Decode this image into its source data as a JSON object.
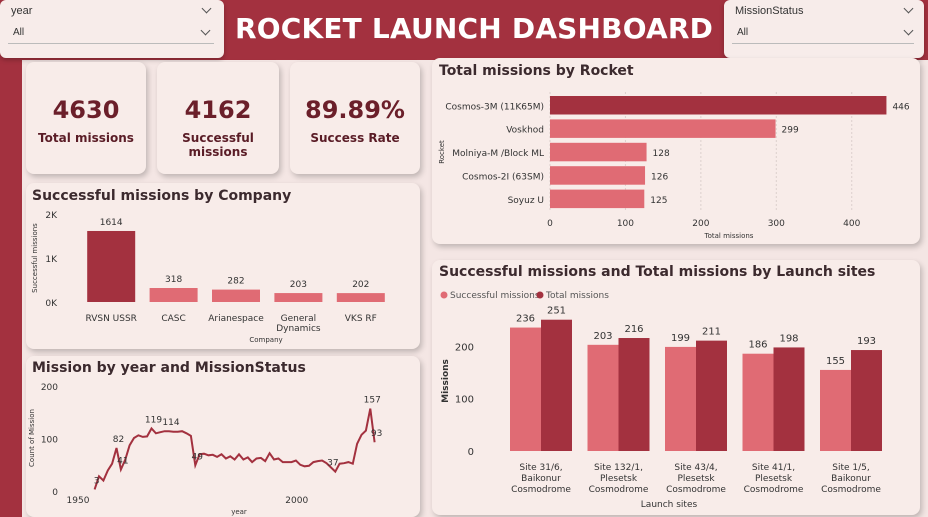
{
  "header": {
    "title": "ROCKET LAUNCH DASHBOARD"
  },
  "filters": {
    "year": {
      "label": "year",
      "value": "All"
    },
    "mission_status": {
      "label": "MissionStatus",
      "value": "All"
    }
  },
  "kpis": [
    {
      "value": "4630",
      "caption": "Total missions"
    },
    {
      "value": "4162",
      "caption": "Successful missions"
    },
    {
      "value": "89.89%",
      "caption": "Success Rate"
    }
  ],
  "colors": {
    "dark": "#a3313f",
    "light": "#e06b74"
  },
  "chart_data": [
    {
      "id": "company",
      "type": "bar",
      "title": "Successful missions by Company",
      "xlabel": "Company",
      "ylabel": "Successful missions",
      "ylim": [
        0,
        2000
      ],
      "yticks": [
        "0K",
        "1K",
        "2K"
      ],
      "categories": [
        "RVSN USSR",
        "CASC",
        "Arianespace",
        "General Dynamics",
        "VKS RF"
      ],
      "category_lines": [
        [
          "RVSN USSR"
        ],
        [
          "CASC"
        ],
        [
          "Arianespace"
        ],
        [
          "General",
          "Dynamics"
        ],
        [
          "VKS RF"
        ]
      ],
      "values": [
        1614,
        318,
        282,
        203,
        202
      ]
    },
    {
      "id": "rocket",
      "type": "bar",
      "orientation": "horizontal",
      "title": "Total missions by Rocket",
      "xlabel": "Total missions",
      "ylabel": "Rocket",
      "xlim": [
        0,
        460
      ],
      "xticks": [
        0,
        100,
        200,
        300,
        400
      ],
      "categories": [
        "Cosmos-3M (11K65M)",
        "Voskhod",
        "Molniya-M /Block ML",
        "Cosmos-2I (63SM)",
        "Soyuz U"
      ],
      "values": [
        446,
        299,
        128,
        126,
        125
      ]
    },
    {
      "id": "sites",
      "type": "bar",
      "title": "Successful missions and Total missions by Launch sites",
      "xlabel": "Launch sites",
      "ylabel": "Missions",
      "ylim": [
        0,
        260
      ],
      "yticks": [
        0,
        100,
        200
      ],
      "categories": [
        "Site 31/6, Baikonur Cosmodrome",
        "Site 132/1, Plesetsk Cosmodrome",
        "Site 43/4, Plesetsk Cosmodrome",
        "Site 41/1, Plesetsk Cosmodrome",
        "Site 1/5, Baikonur Cosmodrome"
      ],
      "category_lines": [
        [
          "Site 31/6,",
          "Baikonur",
          "Cosmodrome"
        ],
        [
          "Site 132/1,",
          "Plesetsk",
          "Cosmodrome"
        ],
        [
          "Site 43/4,",
          "Plesetsk",
          "Cosmodrome"
        ],
        [
          "Site 41/1,",
          "Plesetsk",
          "Cosmodrome"
        ],
        [
          "Site 1/5,",
          "Baikonur",
          "Cosmodrome"
        ]
      ],
      "legend": "top-left",
      "series": [
        {
          "name": "Successful missions",
          "values": [
            236,
            203,
            199,
            186,
            155
          ]
        },
        {
          "name": "Total missions",
          "values": [
            251,
            216,
            211,
            198,
            193
          ]
        }
      ]
    },
    {
      "id": "year",
      "type": "line",
      "title": "Mission by year and MissionStatus",
      "xlabel": "year",
      "ylabel": "Count of Mission",
      "xlim": [
        1950,
        2022
      ],
      "ylim": [
        0,
        200
      ],
      "xticks": [
        1950,
        2000
      ],
      "yticks": [
        0,
        100,
        200
      ],
      "x": [
        1957,
        1958,
        1959,
        1960,
        1961,
        1962,
        1963,
        1964,
        1965,
        1966,
        1967,
        1968,
        1969,
        1970,
        1971,
        1972,
        1973,
        1974,
        1975,
        1976,
        1977,
        1978,
        1979,
        1980,
        1981,
        1982,
        1983,
        1984,
        1985,
        1986,
        1987,
        1988,
        1989,
        1990,
        1991,
        1992,
        1993,
        1994,
        1995,
        1996,
        1997,
        1998,
        1999,
        2000,
        2001,
        2002,
        2003,
        2004,
        2005,
        2006,
        2007,
        2008,
        2009,
        2010,
        2011,
        2012,
        2013,
        2014,
        2015,
        2016,
        2017,
        2018,
        2019,
        2020
      ],
      "values": [
        3,
        28,
        20,
        39,
        52,
        82,
        41,
        60,
        87,
        101,
        106,
        103,
        104,
        119,
        110,
        112,
        114,
        114,
        113,
        113,
        114,
        110,
        105,
        49,
        70,
        71,
        68,
        69,
        65,
        70,
        62,
        66,
        60,
        70,
        60,
        64,
        55,
        62,
        63,
        57,
        72,
        60,
        62,
        55,
        55,
        55,
        58,
        50,
        47,
        48,
        55,
        57,
        58,
        53,
        45,
        37,
        52,
        53,
        55,
        52,
        90,
        107,
        115,
        157
      ],
      "end_value": 93,
      "point_labels": [
        {
          "x": 1957,
          "y": 3,
          "text": "3"
        },
        {
          "x": 1962,
          "y": 82,
          "text": "82"
        },
        {
          "x": 1963,
          "y": 41,
          "text": "41"
        },
        {
          "x": 1970,
          "y": 119,
          "text": "119"
        },
        {
          "x": 1974,
          "y": 114,
          "text": "114"
        },
        {
          "x": 1980,
          "y": 49,
          "text": "49"
        },
        {
          "x": 2011,
          "y": 37,
          "text": "37"
        },
        {
          "x": 2020,
          "y": 157,
          "text": "157"
        },
        {
          "x": 2021,
          "y": 93,
          "text": "93"
        }
      ]
    }
  ]
}
